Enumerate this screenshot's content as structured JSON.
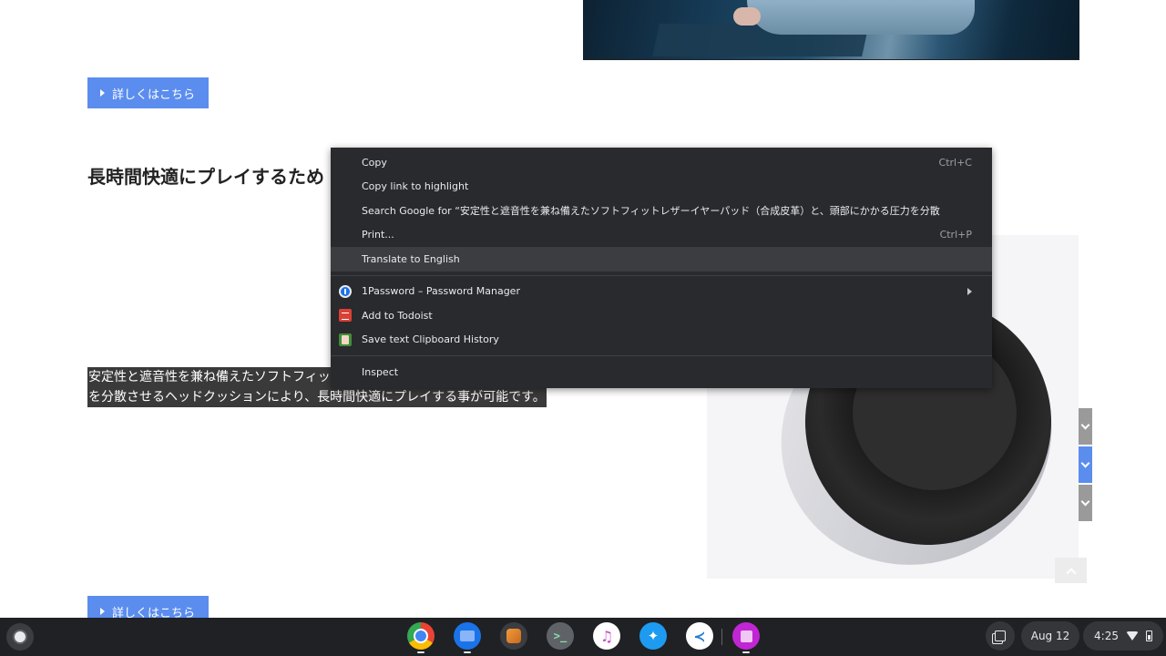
{
  "page": {
    "more_button_label": "詳しくはこちら",
    "heading": "長時間快適にプレイするため",
    "selected_text": {
      "line1": "安定性と遮音性を兼ね備えたソフトフィッ",
      "line2": "を分散させるヘッドクッションにより、長時間快適にプレイする事が可能です。"
    },
    "side_nav": [
      {
        "icon": "chevron-down-icon",
        "active": false
      },
      {
        "icon": "chevron-down-icon",
        "active": true
      },
      {
        "icon": "chevron-down-icon",
        "active": false
      }
    ],
    "accent_color": "#5b8def"
  },
  "context_menu": {
    "items": [
      {
        "label": "Copy",
        "shortcut": "Ctrl+C"
      },
      {
        "label": "Copy link to highlight",
        "shortcut": ""
      },
      {
        "label": "Search Google for “安定性と遮音性を兼ね備えたソフトフィットレザーイヤーパッド（合成皮革）と、頭部にかかる圧力を分散",
        "shortcut": ""
      },
      {
        "label": "Print...",
        "shortcut": "Ctrl+P"
      },
      {
        "label": "Translate to English",
        "shortcut": "",
        "hovered": true
      }
    ],
    "extensions": [
      {
        "label": "1Password – Password Manager",
        "icon": "1password-icon",
        "has_submenu": true
      },
      {
        "label": "Add to Todoist",
        "icon": "todoist-icon"
      },
      {
        "label": "Save text Clipboard History",
        "icon": "clipboard-history-icon"
      }
    ],
    "inspect_label": "Inspect"
  },
  "shelf": {
    "apps": [
      {
        "name": "Chrome",
        "icon": "chrome-icon",
        "running": true
      },
      {
        "name": "Files",
        "icon": "files-icon",
        "running": true
      },
      {
        "name": "Squid",
        "icon": "squid-icon",
        "running": false
      },
      {
        "name": "Terminal",
        "icon": "terminal-icon",
        "glyph": ">_",
        "running": false
      },
      {
        "name": "Apple Music",
        "icon": "music-icon",
        "glyph": "♫",
        "running": false
      },
      {
        "name": "Twitter",
        "icon": "twitter-icon",
        "glyph": "🐦",
        "running": false
      },
      {
        "name": "Visual Studio Code",
        "icon": "vscode-icon",
        "glyph": "≺",
        "running": false
      },
      {
        "name": "App",
        "icon": "pink-app-icon",
        "running": true
      }
    ],
    "date": "Aug 12",
    "time": "4:25"
  }
}
